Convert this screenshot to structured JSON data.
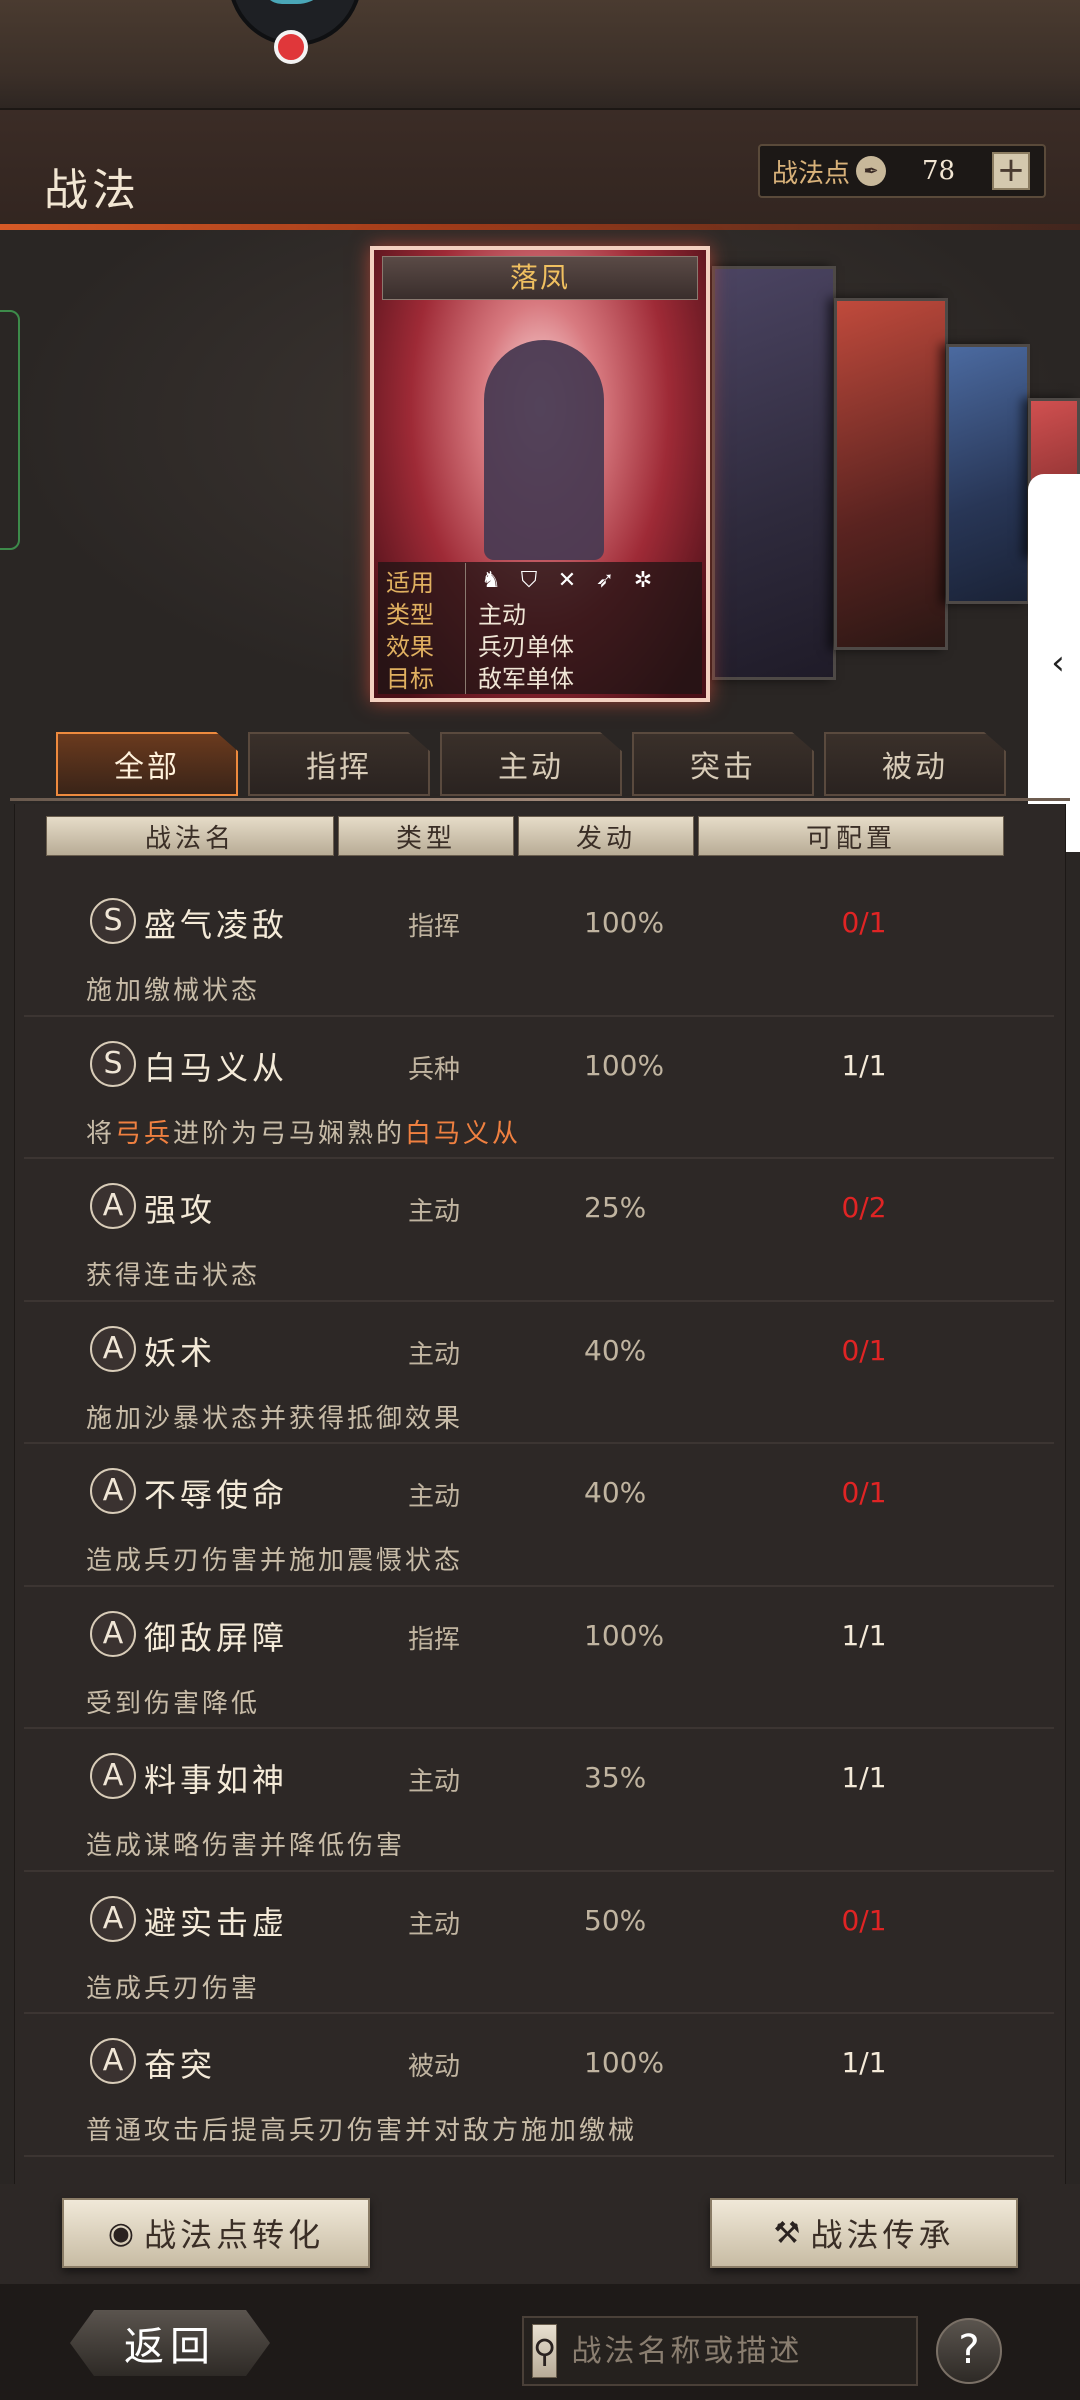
{
  "header": {
    "title": "战法",
    "points_label": "战法点",
    "points_value": "78",
    "add_symbol": "+"
  },
  "card": {
    "name": "落凤",
    "info": [
      {
        "key": "适用",
        "value": ""
      },
      {
        "key": "类型",
        "value": "主动"
      },
      {
        "key": "效果",
        "value": "兵刃单体"
      },
      {
        "key": "目标",
        "value": "敌军单体"
      }
    ],
    "troop_icons": [
      "cavalry-icon",
      "shield-icon",
      "bow-icon",
      "spear-icon",
      "siege-icon"
    ]
  },
  "tabs": [
    "全部",
    "指挥",
    "主动",
    "突击",
    "被动"
  ],
  "active_tab": "全部",
  "columns": [
    "战法名",
    "类型",
    "发动",
    "可配置"
  ],
  "skills": [
    {
      "grade": "S",
      "name": "盛气凌敌",
      "type": "指挥",
      "rate": "100%",
      "config": "0/1",
      "config_warn": true,
      "desc_pre": "施加缴械状态",
      "hl1": "",
      "desc_mid": "",
      "hl2": ""
    },
    {
      "grade": "S",
      "name": "白马义从",
      "type": "兵种",
      "rate": "100%",
      "config": "1/1",
      "config_warn": false,
      "desc_pre": "将",
      "hl1": "弓兵",
      "desc_mid": "进阶为弓马娴熟的",
      "hl2": "白马义从"
    },
    {
      "grade": "A",
      "name": "强攻",
      "type": "主动",
      "rate": "25%",
      "config": "0/2",
      "config_warn": true,
      "desc_pre": "获得连击状态",
      "hl1": "",
      "desc_mid": "",
      "hl2": ""
    },
    {
      "grade": "A",
      "name": "妖术",
      "type": "主动",
      "rate": "40%",
      "config": "0/1",
      "config_warn": true,
      "desc_pre": "施加沙暴状态并获得抵御效果",
      "hl1": "",
      "desc_mid": "",
      "hl2": ""
    },
    {
      "grade": "A",
      "name": "不辱使命",
      "type": "主动",
      "rate": "40%",
      "config": "0/1",
      "config_warn": true,
      "desc_pre": "造成兵刃伤害并施加震慑状态",
      "hl1": "",
      "desc_mid": "",
      "hl2": ""
    },
    {
      "grade": "A",
      "name": "御敌屏障",
      "type": "指挥",
      "rate": "100%",
      "config": "1/1",
      "config_warn": false,
      "desc_pre": "受到伤害降低",
      "hl1": "",
      "desc_mid": "",
      "hl2": ""
    },
    {
      "grade": "A",
      "name": "料事如神",
      "type": "主动",
      "rate": "35%",
      "config": "1/1",
      "config_warn": false,
      "desc_pre": "造成谋略伤害并降低伤害",
      "hl1": "",
      "desc_mid": "",
      "hl2": ""
    },
    {
      "grade": "A",
      "name": "避实击虚",
      "type": "主动",
      "rate": "50%",
      "config": "0/1",
      "config_warn": true,
      "desc_pre": "造成兵刃伤害",
      "hl1": "",
      "desc_mid": "",
      "hl2": ""
    },
    {
      "grade": "A",
      "name": "奋突",
      "type": "被动",
      "rate": "100%",
      "config": "1/1",
      "config_warn": false,
      "desc_pre": "普通攻击后提高兵刃伤害并对敌方施加缴械",
      "hl1": "",
      "desc_mid": "",
      "hl2": ""
    }
  ],
  "actions": {
    "convert_label": "战法点转化",
    "inherit_label": "战法传承"
  },
  "footer": {
    "back_label": "返回",
    "search_placeholder": "战法名称或描述",
    "help_symbol": "?"
  },
  "colors": {
    "accent": "#ee8a3e",
    "warn": "#e02424",
    "highlight": "#f08040"
  }
}
